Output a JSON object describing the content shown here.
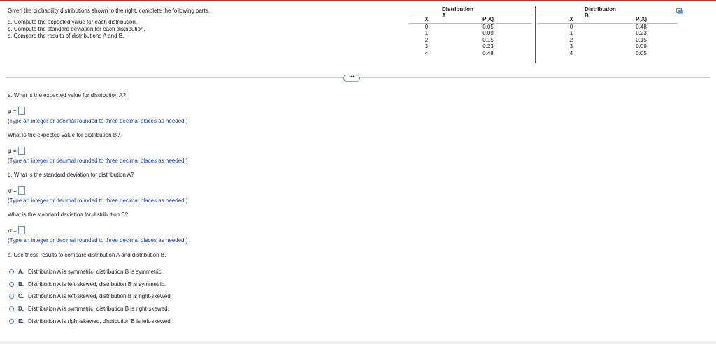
{
  "intro": {
    "lead": "Given the probability distributions shown to the right, complete the following parts.",
    "parts": [
      "a. Compute the expected value for each distribution.",
      "b. Compute the standard deviation for each distribution.",
      "c. Compare the results of distributions A and B."
    ]
  },
  "distA": {
    "title": "Distribution A",
    "col_x": "X",
    "col_p": "P(X)",
    "rows": [
      {
        "x": "0",
        "p": "0.05"
      },
      {
        "x": "1",
        "p": "0.09"
      },
      {
        "x": "2",
        "p": "0.15"
      },
      {
        "x": "3",
        "p": "0.23"
      },
      {
        "x": "4",
        "p": "0.48"
      }
    ]
  },
  "distB": {
    "title": "Distribution B",
    "col_x": "X",
    "col_p": "P(X)",
    "rows": [
      {
        "x": "0",
        "p": "0.48"
      },
      {
        "x": "1",
        "p": "0.23"
      },
      {
        "x": "2",
        "p": "0.15"
      },
      {
        "x": "3",
        "p": "0.09"
      },
      {
        "x": "4",
        "p": "0.05"
      }
    ]
  },
  "expand_label": "•••",
  "questions": {
    "a_title": "a. What is the expected value for distribution A?",
    "mu_sym": "μ =",
    "hint": "(Type an integer or decimal rounded to three decimal places as needed.)",
    "a_b_question": "What is the expected value for distribution B?",
    "b_title": "b. What is the standard deviation for distribution A?",
    "sigma_sym": "σ =",
    "b_b_question": "What is the standard deviation for distribution B?",
    "c_title": "c. Use these results to compare distribution A and distribution B."
  },
  "options": [
    {
      "letter": "A.",
      "text": "Distribution A is symmetric, distribution B is symmetric."
    },
    {
      "letter": "B.",
      "text": "Distribution A is left-skewed, distribution B is symmetric."
    },
    {
      "letter": "C.",
      "text": "Distribution A is left-skewed, distribution B is right-skewed."
    },
    {
      "letter": "D.",
      "text": "Distribution A is symmetric, distribution B is right-skewed."
    },
    {
      "letter": "E.",
      "text": "Distribution A is right-skewed, distribution B is left-skewed."
    }
  ],
  "colors": {
    "accent": "#1c3c8c",
    "input_border": "#6b95c9",
    "top_line": "#b3323a"
  }
}
